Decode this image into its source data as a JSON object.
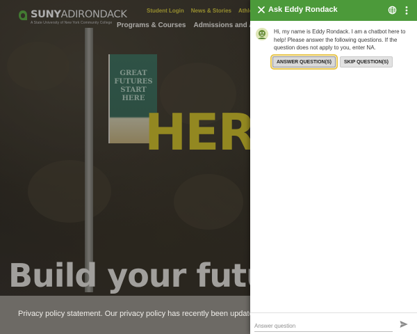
{
  "site": {
    "logo": {
      "name_bold": "SUNY",
      "name_rest": "ADIRONDACK",
      "tagline": "A State University of New York Community College"
    },
    "utility_links": [
      "Student Login",
      "News & Stories",
      "Athletics"
    ],
    "main_nav": [
      "Programs & Courses",
      "Admissions and A"
    ],
    "banner_lines": [
      "GREAT",
      "FUTURES",
      "START",
      "HERE"
    ],
    "hero_word": "HERE",
    "hero_subtitle": "Build your futu",
    "privacy_text": "Privacy policy statement. Our privacy policy has recently been updated"
  },
  "chat": {
    "header": {
      "title": "Ask Eddy Rondack",
      "close_icon": "close-icon",
      "globe_icon": "globe-icon",
      "more_icon": "more-vertical-icon"
    },
    "message": {
      "text": "Hi, my name is Eddy Rondack. I am a chatbot here to help! Please answer the following questions. If the question does not apply to you, enter NA."
    },
    "buttons": {
      "answer": "ANSWER QUESTION(S)",
      "skip": "SKIP QUESTION(S)"
    },
    "input": {
      "placeholder": "Answer question",
      "value": ""
    },
    "colors": {
      "header_bg": "#4c9a3a",
      "focus_ring": "#e6c44a",
      "site_accent": "#c5b62c"
    }
  }
}
